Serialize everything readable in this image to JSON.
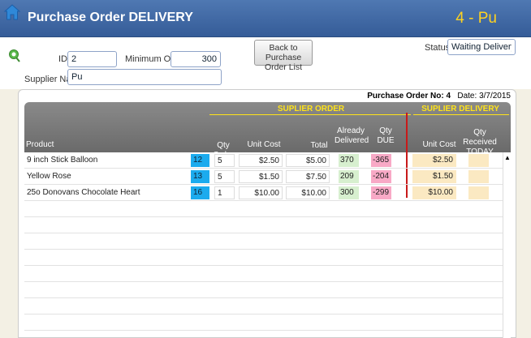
{
  "header": {
    "title": "Purchase Order DELIVERY",
    "right_text": "4 - Pu",
    "bg_color": "#4a73ad"
  },
  "form": {
    "id_label": "ID",
    "id_value": "2",
    "min_order_label": "Minimum Order",
    "min_order_value": "300",
    "supplier_label": "Supplier Name",
    "supplier_value": "Pu",
    "back_button": "Back to Purchase Order List",
    "status_label": "Status",
    "status_value": "Waiting Delivery"
  },
  "po": {
    "no_label": "Purchase Order No:",
    "no_value": "4",
    "date_label": "Date:",
    "date_value": "3/7/2015"
  },
  "grid": {
    "group_order": "SUPLIER ORDER",
    "group_delivery": "SUPLIER DELIVERY",
    "columns": {
      "product": "Product",
      "qty_order": "Qty Order",
      "unit_cost": "Unit Cost",
      "total": "Total",
      "already_delivered": "Already Delivered",
      "qty_due": "Qty DUE",
      "del_unit_cost": "Unit Cost",
      "qty_received": "Qty Received TODAY"
    },
    "rows": [
      {
        "product": "9 inch Stick Balloon",
        "num": "12",
        "qty": "5",
        "unit_cost": "$2.50",
        "total": "$5.00",
        "delivered": "370",
        "due": "-365",
        "del_cost": "$2.50",
        "received": ""
      },
      {
        "product": "Yellow Rose",
        "num": "13",
        "qty": "5",
        "unit_cost": "$1.50",
        "total": "$7.50",
        "delivered": "209",
        "due": "-204",
        "del_cost": "$1.50",
        "received": ""
      },
      {
        "product": "25o Donovans Chocolate Heart",
        "num": "16",
        "qty": "1",
        "unit_cost": "$10.00",
        "total": "$10.00",
        "delivered": "300",
        "due": "-299",
        "del_cost": "$10.00",
        "received": ""
      }
    ]
  },
  "colors": {
    "group_text": "#ffe31a",
    "divider": "#c81a1a",
    "num_cell": "#1cabee",
    "delivered_cell": "#d7efcf",
    "due_cell": "#f8a9c6",
    "delivery_cell": "#fbe9c2"
  }
}
